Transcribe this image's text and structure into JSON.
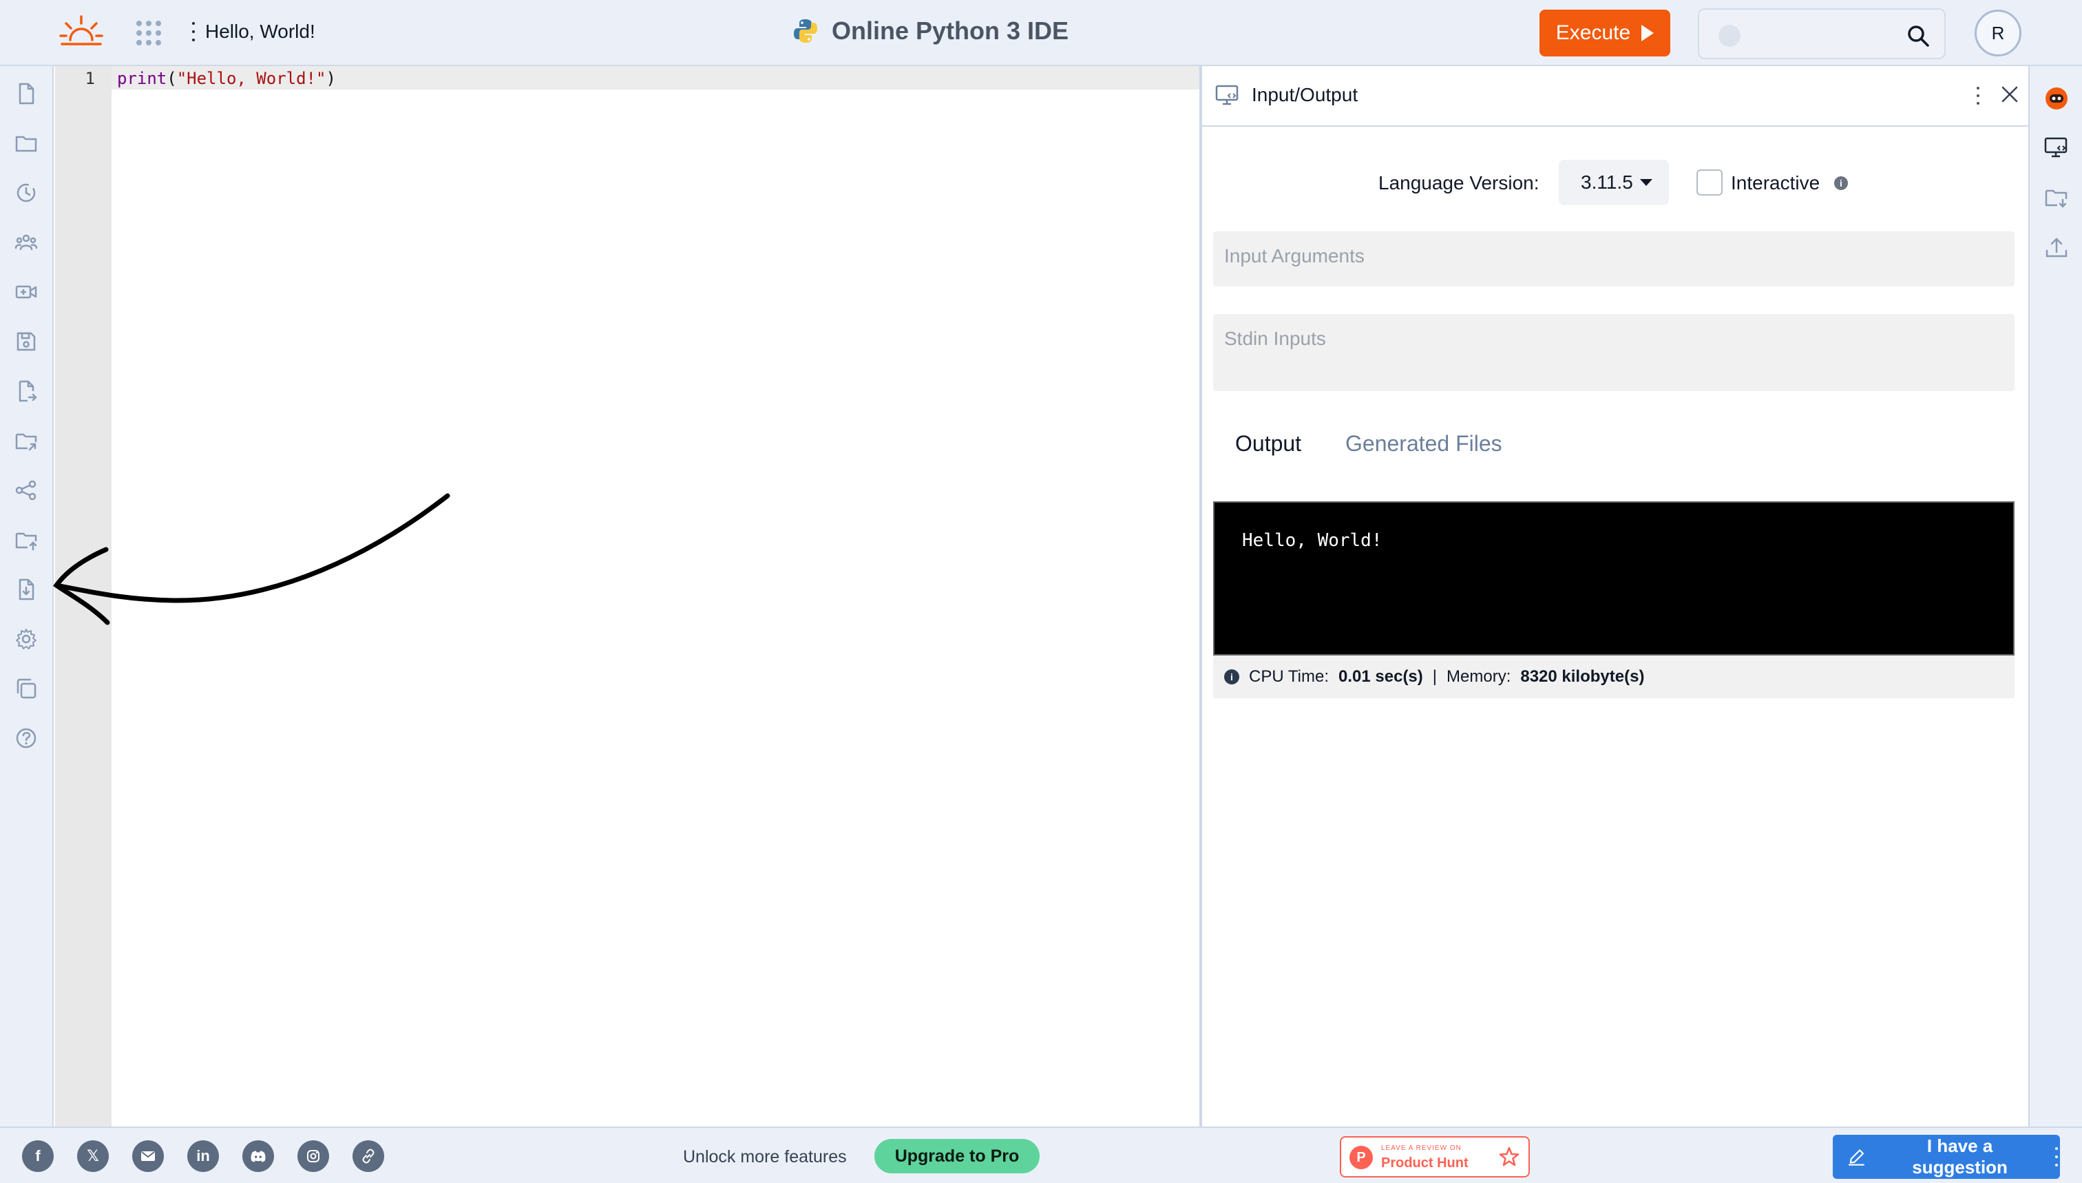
{
  "header": {
    "file_name": "Hello, World!",
    "title": "Online Python 3 IDE",
    "execute_label": "Execute",
    "search_placeholder": "",
    "avatar_initial": "R"
  },
  "left_sidebar": {
    "icons": [
      "new-file-icon",
      "folder-icon",
      "history-icon",
      "collaborate-icon",
      "add-video-icon",
      "save-icon",
      "save-as-icon",
      "move-folder-icon",
      "share-icon",
      "upload-folder-icon",
      "download-file-icon",
      "settings-icon",
      "copy-icon",
      "help-icon"
    ]
  },
  "editor": {
    "line_number": "1",
    "code": {
      "fn": "print",
      "open": "(",
      "arg": "\"Hello, World!\"",
      "close": ")"
    }
  },
  "io_panel": {
    "title": "Input/Output",
    "language_label": "Language Version:",
    "language_version": "3.11.5",
    "interactive_label": "Interactive",
    "interactive_checked": false,
    "input_arguments_placeholder": "Input Arguments",
    "stdin_placeholder": "Stdin Inputs",
    "tabs": {
      "output": "Output",
      "generated_files": "Generated Files"
    },
    "console_output": "Hello, World!",
    "stats": {
      "cpu_label": "CPU Time:",
      "cpu_value": "0.01 sec(s)",
      "separator": "|",
      "memory_label": "Memory:",
      "memory_value": "8320 kilobyte(s)"
    }
  },
  "right_sidebar": {
    "icons": [
      "assistant-icon",
      "io-panel-icon",
      "download-folder-icon",
      "upload-icon"
    ]
  },
  "footer": {
    "social": [
      "facebook-icon",
      "x-icon",
      "email-icon",
      "linkedin-icon",
      "discord-icon",
      "instagram-icon",
      "link-icon"
    ],
    "unlock_text": "Unlock more features",
    "upgrade_label": "Upgrade to Pro",
    "producthunt_small": "LEAVE A REVIEW ON",
    "producthunt_big": "Product Hunt",
    "suggestion_label": "I have a suggestion"
  },
  "colors": {
    "accent": "#f25a0d",
    "chrome_bg": "#ebf0f8",
    "upgrade": "#5fd39c",
    "suggest": "#2f7de1"
  }
}
